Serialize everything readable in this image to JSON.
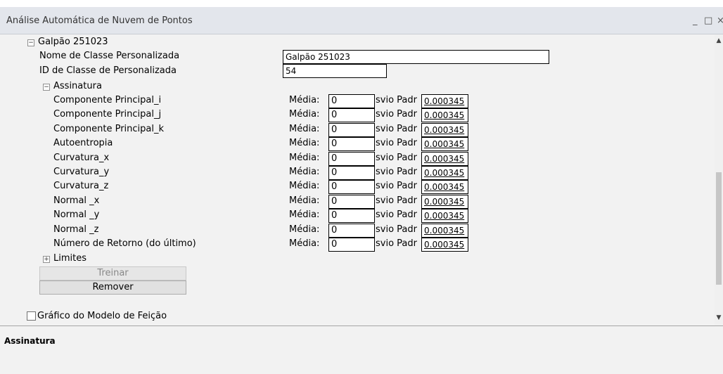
{
  "window": {
    "title": "Análise Automática de Nuvem de Pontos",
    "minimize_glyph": "_",
    "restore_glyph": "□",
    "close_glyph": "×"
  },
  "tree": {
    "root_label": "Galpão 251023",
    "root_state": "collapse",
    "custom_class_name": {
      "label": "Nome de Classe Personalizada",
      "value": "Galpão 251023"
    },
    "custom_class_id": {
      "label": "ID de Classe de Personalizada",
      "value": "54"
    },
    "signature_label": "Assinatura",
    "signature_state": "collapse",
    "mean_label": "Média:",
    "std_label": "svio Padr",
    "features": [
      {
        "label": "Componente Principal_i",
        "mean": "0",
        "std": "0.000345"
      },
      {
        "label": "Componente Principal_j",
        "mean": "0",
        "std": "0.000345"
      },
      {
        "label": "Componente Principal_k",
        "mean": "0",
        "std": "0.000345"
      },
      {
        "label": "Autoentropia",
        "mean": "0",
        "std": "0.000345"
      },
      {
        "label": "Curvatura_x",
        "mean": "0",
        "std": "0.000345"
      },
      {
        "label": "Curvatura_y",
        "mean": "0",
        "std": "0.000345"
      },
      {
        "label": "Curvatura_z",
        "mean": "0",
        "std": "0.000345"
      },
      {
        "label": "Normal _x",
        "mean": "0",
        "std": "0.000345"
      },
      {
        "label": "Normal _y",
        "mean": "0",
        "std": "0.000345"
      },
      {
        "label": "Normal _z",
        "mean": "0",
        "std": "0.000345"
      },
      {
        "label": "Número de Retorno (do último)",
        "mean": "0",
        "std": "0.000345"
      }
    ],
    "limits_label": "Limites",
    "limits_state": "expand"
  },
  "buttons": {
    "train_label": "Treinar",
    "remove_label": "Remover"
  },
  "feature_model_chart": {
    "label": "Gráfico do Modelo de Feição",
    "checked": false
  },
  "description_panel": {
    "title": "Assinatura"
  }
}
